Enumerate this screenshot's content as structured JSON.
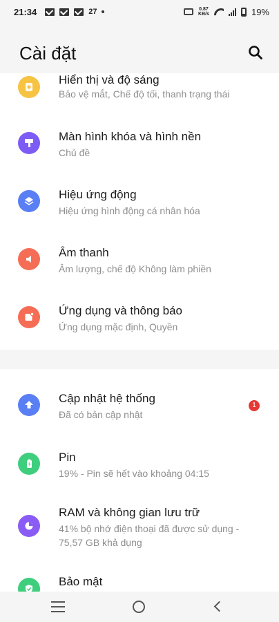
{
  "status_bar": {
    "time": "21:34",
    "temperature": "27",
    "speed_value": "0.87",
    "speed_unit": "KB/s",
    "battery": "19%"
  },
  "header": {
    "title": "Cài đặt",
    "search_icon": "search-icon"
  },
  "colors": {
    "display": "#f6c343",
    "lockscreen": "#7d5cf5",
    "animation": "#5a7ff5",
    "sound": "#f56d54",
    "apps": "#f56d54",
    "update": "#5a7ff5",
    "battery": "#3fce7d",
    "storage": "#8a5cf5",
    "security": "#3fce7d",
    "badge": "#e53935"
  },
  "section1": [
    {
      "title": "Hiển thị và độ sáng",
      "subtitle": "Bảo vệ mắt, Chế độ tối, thanh trạng thái",
      "icon": "brightness-icon"
    },
    {
      "title": "Màn hình khóa và hình nền",
      "subtitle": "Chủ đề",
      "icon": "paint-roller-icon"
    },
    {
      "title": "Hiệu ứng động",
      "subtitle": "Hiệu ứng hình động cá nhân hóa",
      "icon": "layers-icon"
    },
    {
      "title": "Âm thanh",
      "subtitle": "Âm lượng, chế độ Không làm phiền",
      "icon": "speaker-icon"
    },
    {
      "title": "Ứng dụng và thông báo",
      "subtitle": "Ứng dụng mặc định, Quyền",
      "icon": "app-notification-icon"
    }
  ],
  "section2": [
    {
      "title": "Cập nhật hệ thống",
      "subtitle": "Đã có bản cập nhật",
      "icon": "update-arrow-icon",
      "badge": "1"
    },
    {
      "title": "Pin",
      "subtitle": "19% - Pin sẽ hết vào khoảng 04:15",
      "icon": "battery-icon"
    },
    {
      "title": "RAM và không gian lưu trữ",
      "subtitle": "41% bộ nhớ điện thoại đã được sử dụng - 75,57 GB khả dụng",
      "icon": "pie-chart-icon"
    },
    {
      "title": "Bảo mật",
      "subtitle": "",
      "icon": "shield-check-icon"
    }
  ],
  "navbar": {
    "menu_icon": "menu-icon",
    "home_icon": "home-circle-icon",
    "back_icon": "back-chevron-icon"
  }
}
